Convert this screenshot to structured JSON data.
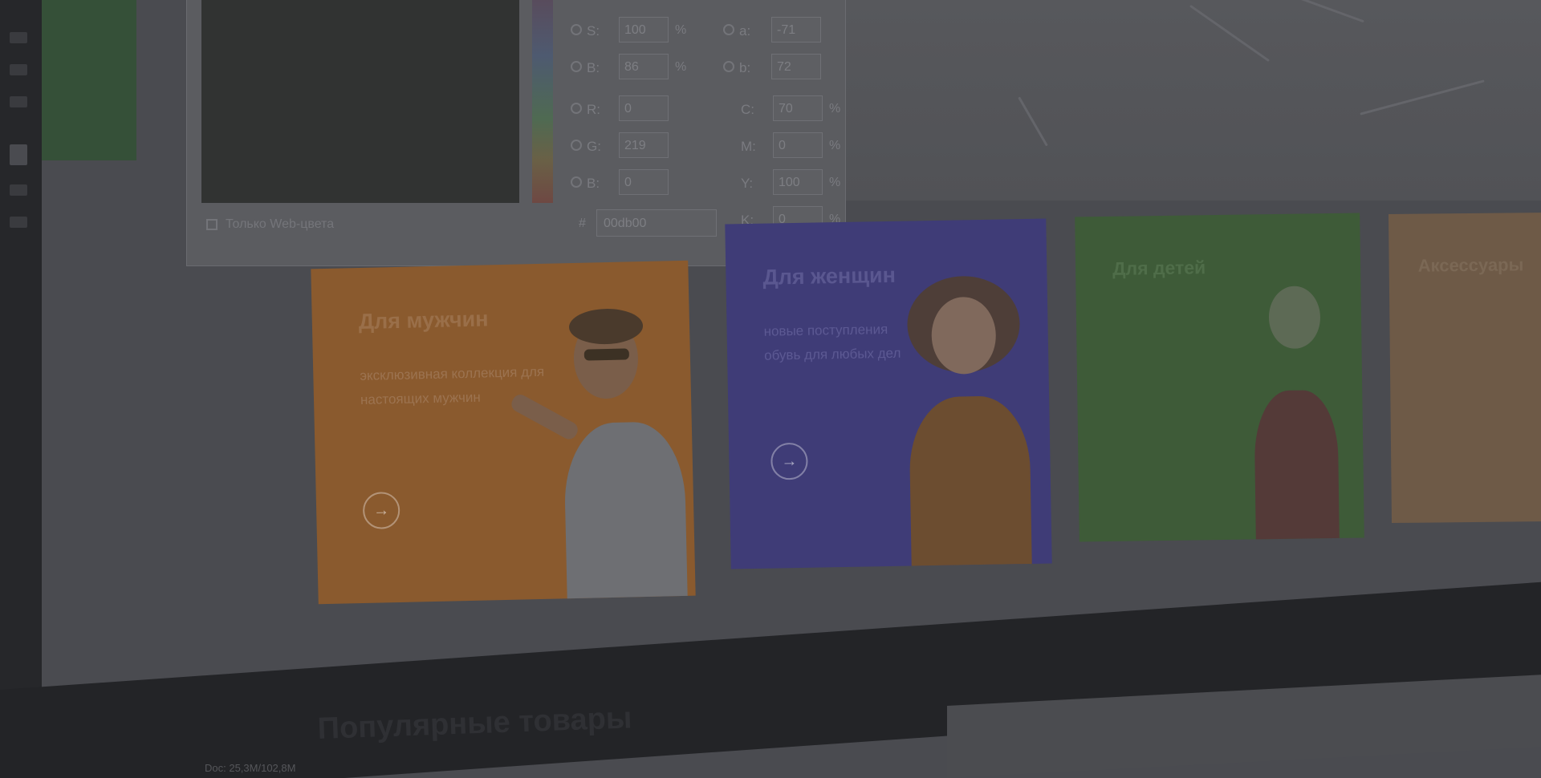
{
  "picker": {
    "rows_left": [
      {
        "label": "S:",
        "value": "100",
        "unit": "%"
      },
      {
        "label": "B:",
        "value": "86",
        "unit": "%"
      },
      {
        "label": "R:",
        "value": "0",
        "unit": ""
      },
      {
        "label": "G:",
        "value": "219",
        "unit": ""
      },
      {
        "label": "B:",
        "value": "0",
        "unit": ""
      }
    ],
    "rows_right": [
      {
        "label": "a:",
        "value": "-71",
        "unit": ""
      },
      {
        "label": "b:",
        "value": "72",
        "unit": ""
      },
      {
        "label": "C:",
        "value": "70",
        "unit": "%"
      },
      {
        "label": "M:",
        "value": "0",
        "unit": "%"
      },
      {
        "label": "Y:",
        "value": "100",
        "unit": "%"
      },
      {
        "label": "K:",
        "value": "0",
        "unit": "%"
      }
    ],
    "hex_label": "#",
    "hex_value": "00db00",
    "web_only_label": "Только Web-цвета"
  },
  "cards": [
    {
      "title": "Для мужчин",
      "text": "эксклюзивная коллекция для настоящих мужчин",
      "arrow": "→",
      "color": "#8a5a2e",
      "title_color": "#9a6f49",
      "text_color": "#9c7350"
    },
    {
      "title": "Для женщин",
      "text": "новые поступления обувь для любых дел",
      "arrow": "→",
      "color": "#3f3c77",
      "title_color": "#5a5790",
      "text_color": "#5c5993"
    },
    {
      "title": "Для детей",
      "text": "",
      "arrow": "",
      "color": "#3e5b38",
      "title_color": "#4f6d49",
      "text_color": "#4f6d49"
    },
    {
      "title": "Аксессуары",
      "text": "",
      "arrow": "",
      "color": "#6e5a47",
      "title_color": "#7b6855",
      "text_color": "#7b6855"
    }
  ],
  "section_title": "Популярные товары",
  "status_text": "Doc: 25,3M/102,8M"
}
